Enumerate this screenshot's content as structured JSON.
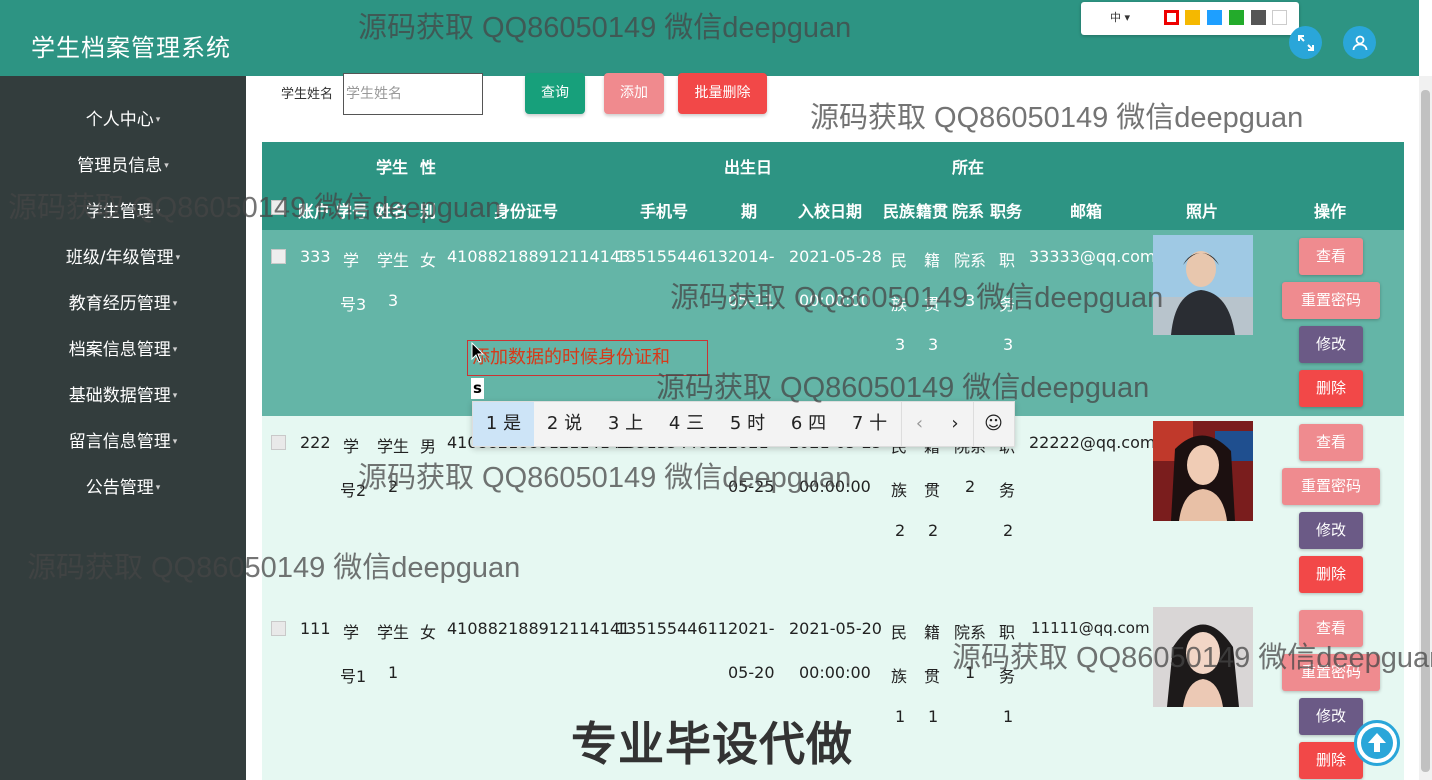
{
  "header": {
    "app_title": "学生档案管理系统",
    "lang": "中",
    "theme_colors": [
      "#ff0000",
      "#f5b800",
      "#1e9fff",
      "#23ab2b",
      "#555555",
      "#ffffff"
    ]
  },
  "sidebar": {
    "items": [
      {
        "label": "个人中心"
      },
      {
        "label": "管理员信息"
      },
      {
        "label": "学生管理"
      },
      {
        "label": "班级/年级管理"
      },
      {
        "label": "教育经历管理"
      },
      {
        "label": "档案信息管理"
      },
      {
        "label": "基础数据管理"
      },
      {
        "label": "留言信息管理"
      },
      {
        "label": "公告管理"
      }
    ]
  },
  "search": {
    "label": "学生姓名",
    "placeholder": "学生姓名",
    "query_btn": "查询",
    "add_btn": "添加",
    "batch_delete_btn": "批量删除"
  },
  "table": {
    "headers": {
      "account": "账户",
      "student_no": "学号",
      "student_name_top": "学生",
      "student_name_bottom": "姓名",
      "gender_top": "性",
      "gender_bottom": "别",
      "id_card": "身份证号",
      "phone": "手机号",
      "birth_top": "出生日",
      "birth_bottom": "期",
      "enroll_date": "入校日期",
      "ethnicity": "民族",
      "origin": "籍贯",
      "dept_top": "所在",
      "dept_bottom": "院系",
      "position": "职务",
      "email": "邮箱",
      "photo": "照片",
      "actions": "操作"
    },
    "rows": [
      {
        "account": "333",
        "no_1": "学",
        "no_2": "号3",
        "name_1": "学生",
        "name_2": "3",
        "gender": "女",
        "id_card": "410882188912114143",
        "phone": "13515544613",
        "birth_1": "2014-",
        "birth_2": "05-11",
        "enroll_1": "2021-05-28",
        "enroll_2": "00:00:00",
        "eth_1": "民",
        "eth_2": "族",
        "eth_3": "3",
        "org_1": "籍",
        "org_2": "贯",
        "org_3": "3",
        "dept_1": "院系",
        "dept_2": "3",
        "pos_1": "职",
        "pos_2": "务",
        "pos_3": "3",
        "email": "33333@qq.com"
      },
      {
        "account": "222",
        "no_1": "学",
        "no_2": "号2",
        "name_1": "学生",
        "name_2": "2",
        "gender": "男",
        "id_card": "410882188912114142",
        "phone": "13515544612",
        "birth_1": "2021-",
        "birth_2": "05-25",
        "enroll_1": "2021-05-25",
        "enroll_2": "00:00:00",
        "eth_1": "民",
        "eth_2": "族",
        "eth_3": "2",
        "org_1": "籍",
        "org_2": "贯",
        "org_3": "2",
        "dept_1": "院系",
        "dept_2": "2",
        "pos_1": "职",
        "pos_2": "务",
        "pos_3": "2",
        "email": "22222@qq.com"
      },
      {
        "account": "111",
        "no_1": "学",
        "no_2": "号1",
        "name_1": "学生",
        "name_2": "1",
        "gender": "女",
        "id_card": "410882188912114141",
        "phone": "13515544611",
        "birth_1": "2021-",
        "birth_2": "05-20",
        "enroll_1": "2021-05-20",
        "enroll_2": "00:00:00",
        "eth_1": "民",
        "eth_2": "族",
        "eth_3": "1",
        "org_1": "籍",
        "org_2": "贯",
        "org_3": "1",
        "dept_1": "院系",
        "dept_2": "1",
        "pos_1": "职",
        "pos_2": "务",
        "pos_3": "1",
        "email": "11111@qq.com"
      }
    ],
    "row_actions": {
      "view": "查看",
      "reset_password": "重置密码",
      "edit": "修改",
      "delete": "删除"
    }
  },
  "ime": {
    "composition": "添加数据的时候身份证和",
    "typed": "s",
    "candidates": [
      "1 是",
      "2 说",
      "3 上",
      "4 三",
      "5 时",
      "6 四",
      "7 十"
    ],
    "prev": "‹",
    "next": "›",
    "emoji": "☺"
  },
  "watermarks": {
    "text": "源码获取 QQ86050149 微信deepguan",
    "big": "专业毕设代做"
  }
}
